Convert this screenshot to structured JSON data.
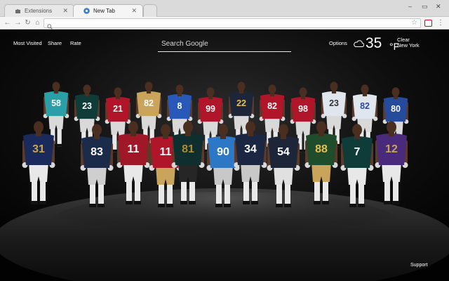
{
  "browser": {
    "tabs": [
      {
        "label": "Extensions",
        "icon": "puzzle-icon",
        "active": false
      },
      {
        "label": "New Tab",
        "icon": "new-tab-icon",
        "active": true
      }
    ],
    "address_value": "",
    "address_placeholder": ""
  },
  "page": {
    "nav": {
      "most_visited": "Most Visited",
      "share": "Share",
      "rate": "Rate"
    },
    "search": {
      "placeholder": "Search Google"
    },
    "options_label": "Options",
    "weather": {
      "temperature": "35",
      "unit": "°F",
      "condition": "Clear",
      "location": "New York",
      "icon": "cloud-icon"
    },
    "support_label": "Support"
  },
  "players": {
    "front": [
      "31",
      "83",
      "11",
      "11",
      "81",
      "90",
      "34",
      "54",
      "88",
      "7",
      "12"
    ],
    "back": [
      "58",
      "23",
      "21",
      "82",
      "8",
      "99",
      "22",
      "82",
      "98",
      "23",
      "82",
      "80"
    ],
    "colors": {
      "rams": "#1a2a5a",
      "patriots": "#1b2b4a",
      "cardinals": "#a01828",
      "niners": "#b0152a",
      "jaguars": "#0f2e2e",
      "lions": "#2d78c6",
      "seahawks": "#1b2742",
      "bears": "#1d2538",
      "packers": "#1f4d2c",
      "eagles": "#0f3b38",
      "vikings": "#4a2a7a",
      "gold": "#c9a45a",
      "dolphins": "#2a9fa8",
      "cowboys": "#e0e6ee",
      "bills": "#2858b8",
      "giants": "#274b9c"
    }
  }
}
